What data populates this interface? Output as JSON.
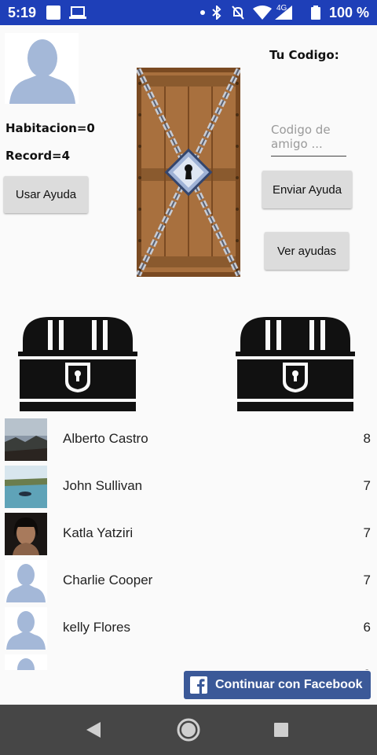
{
  "status_bar": {
    "time": "5:19",
    "network": "4G",
    "battery": "100 %"
  },
  "profile": {
    "room_label": "Habitacion=0",
    "record_label": "Record=4"
  },
  "code": {
    "label": "Tu Codigo:",
    "friend_placeholder": "Codigo de amigo ..."
  },
  "buttons": {
    "use_help": "Usar Ayuda",
    "send_help": "Enviar Ayuda",
    "view_helps": "Ver ayudas"
  },
  "leaderboard": [
    {
      "name": "Alberto Castro",
      "score": "8",
      "avatar": "photo-landscape"
    },
    {
      "name": "John Sullivan",
      "score": "7",
      "avatar": "photo-water"
    },
    {
      "name": "Katla Yatziri",
      "score": "7",
      "avatar": "photo-portrait"
    },
    {
      "name": "Charlie Cooper",
      "score": "7",
      "avatar": "default-avatar"
    },
    {
      "name": "kelly Flores",
      "score": "6",
      "avatar": "default-avatar"
    },
    {
      "name": "",
      "score": "0",
      "avatar": "default-avatar"
    }
  ],
  "facebook": {
    "label": "Continuar con Facebook",
    "color": "#3b5998"
  },
  "colors": {
    "status_bar": "#1e3fb8",
    "nav_bar": "#464646",
    "avatar_blue": "#a4b8d8"
  }
}
